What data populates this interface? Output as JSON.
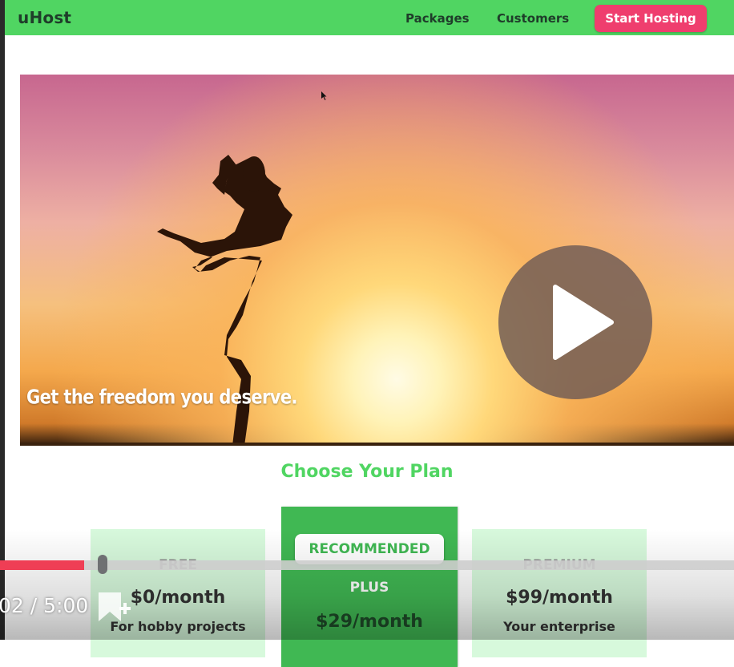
{
  "header": {
    "brand": "uHost",
    "nav": [
      "Packages",
      "Customers"
    ],
    "cta_label": "Start Hosting",
    "colors": {
      "bar": "#50d562",
      "cta": "#ef3e6e"
    }
  },
  "hero": {
    "caption": "Get the freedom you deserve.",
    "play_icon": "play-icon"
  },
  "pricing": {
    "title": "Choose Your Plan",
    "plans": [
      {
        "name": "FREE",
        "price": "$0/month",
        "description": "For hobby projects"
      },
      {
        "badge": "RECOMMENDED",
        "name": "PLUS",
        "price": "$29/month"
      },
      {
        "name": "PREMIUM",
        "price": "$99/month",
        "description": "Your enterprise"
      }
    ]
  },
  "video_player": {
    "time": "02 / 5:00",
    "progress": 0.115,
    "bookmark_icon": "bookmark-add-icon"
  }
}
